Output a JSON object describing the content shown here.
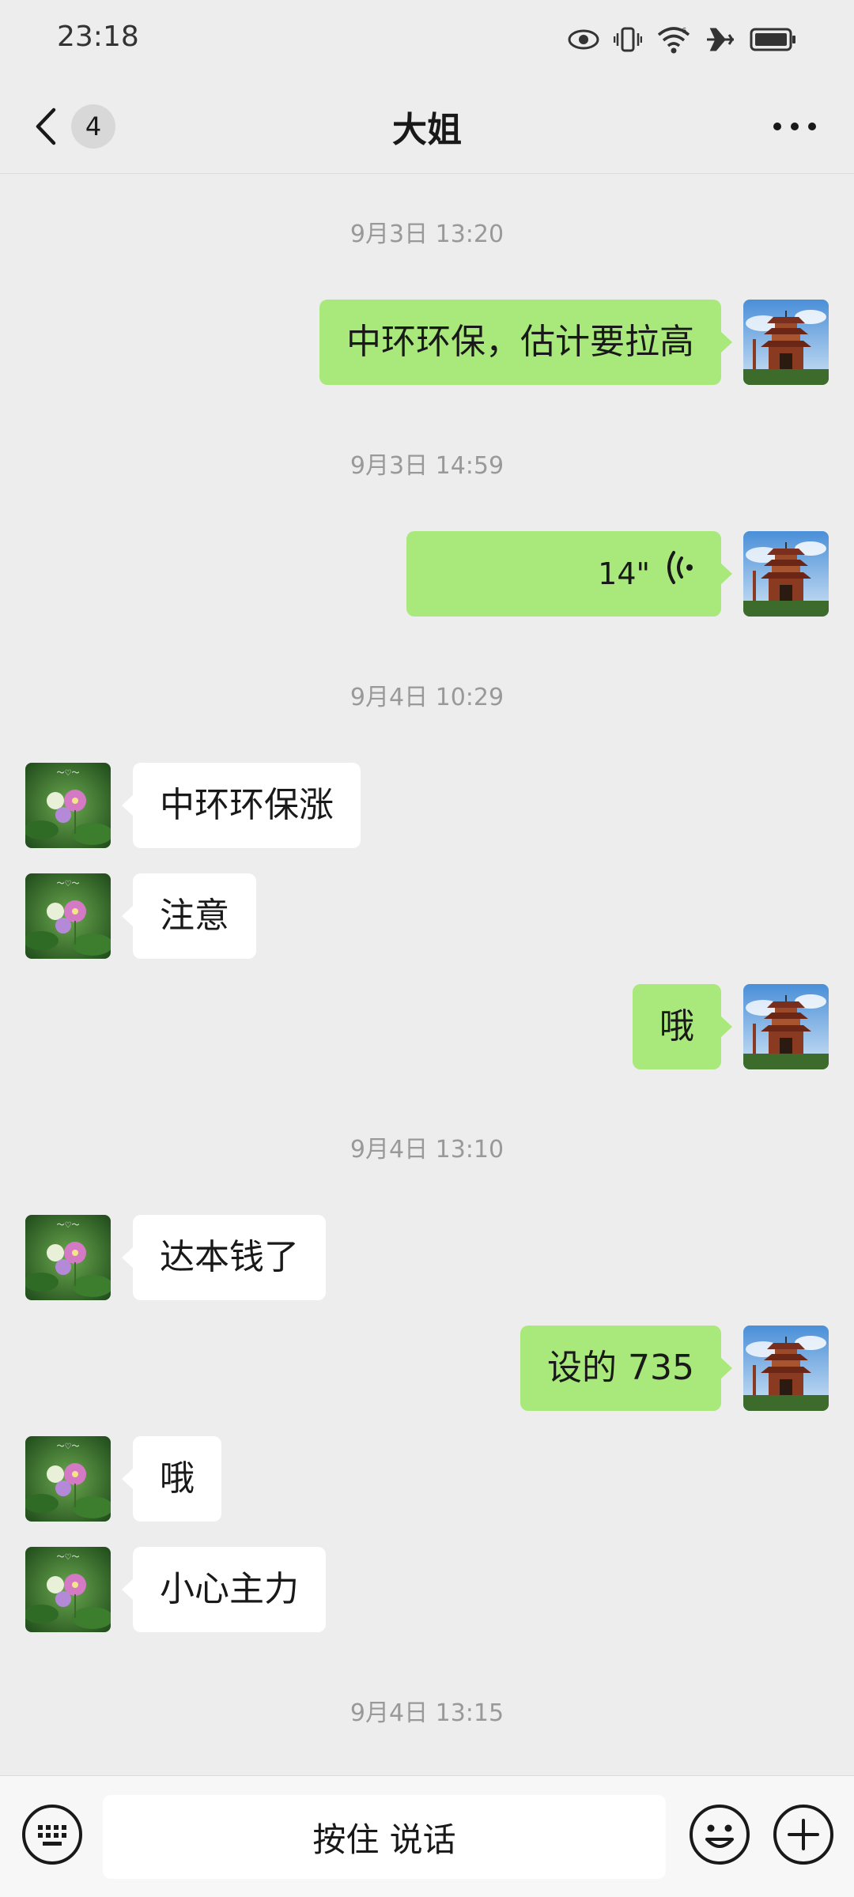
{
  "status_bar": {
    "time": "23:18",
    "icons": [
      "eye-icon",
      "vibrate-icon",
      "wifi-icon",
      "airplane-icon",
      "battery-icon"
    ]
  },
  "header": {
    "back_icon": "chevron-left-icon",
    "unread_count": "4",
    "title": "大姐",
    "more_icon": "more-icon"
  },
  "messages": [
    {
      "type": "timestamp",
      "text": "9月3日 13:20"
    },
    {
      "type": "text",
      "from": "self",
      "text": "中环环保，估计要拉高"
    },
    {
      "type": "timestamp",
      "text": "9月3日 14:59"
    },
    {
      "type": "voice",
      "from": "self",
      "duration": "14\""
    },
    {
      "type": "timestamp",
      "text": "9月4日 10:29"
    },
    {
      "type": "text",
      "from": "other",
      "text": "中环环保涨"
    },
    {
      "type": "text",
      "from": "other",
      "text": "注意"
    },
    {
      "type": "text",
      "from": "self",
      "text": "哦"
    },
    {
      "type": "timestamp",
      "text": "9月4日 13:10"
    },
    {
      "type": "text",
      "from": "other",
      "text": "达本钱了"
    },
    {
      "type": "text",
      "from": "self",
      "text": "设的 735"
    },
    {
      "type": "text",
      "from": "other",
      "text": "哦"
    },
    {
      "type": "text",
      "from": "other",
      "text": "小心主力"
    },
    {
      "type": "timestamp",
      "text": "9月4日 13:15"
    }
  ],
  "input_bar": {
    "keyboard_icon": "keyboard-icon",
    "hold_to_talk_label": "按住 说话",
    "emoji_icon": "emoji-icon",
    "plus_icon": "plus-icon"
  },
  "colors": {
    "background": "#ededed",
    "self_bubble": "#a9e97b",
    "other_bubble": "#ffffff",
    "timestamp_text": "#999999"
  }
}
